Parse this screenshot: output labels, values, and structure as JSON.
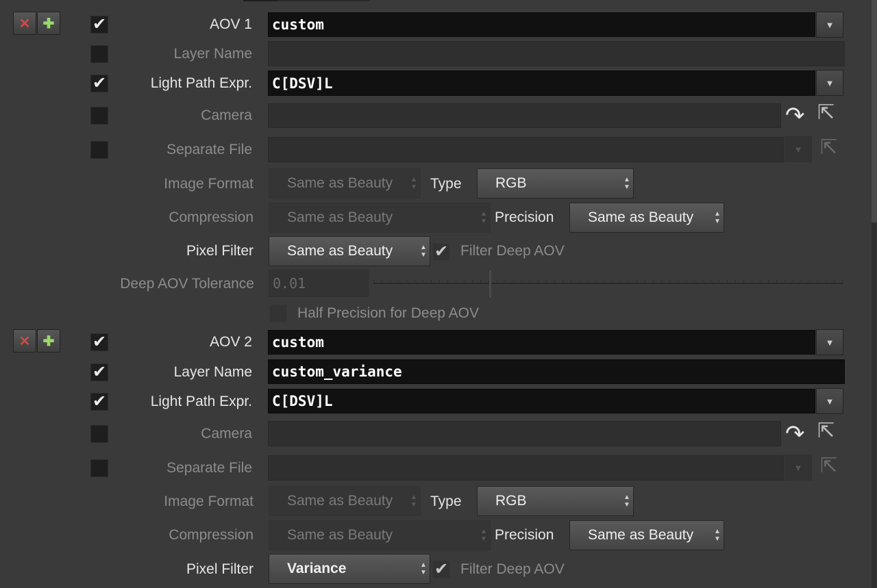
{
  "window": {
    "title": ""
  },
  "aovs": [
    {
      "label": "AOV 1",
      "variable": "custom",
      "layer_name_label": "Layer Name",
      "layer_name": "",
      "lpe_label": "Light Path Expr.",
      "lpe": "C[DSV]L",
      "camera_label": "Camera",
      "separate_file_label": "Separate File",
      "image_format_label": "Image Format",
      "image_format": "Same as Beauty",
      "type_label": "Type",
      "type": "RGB",
      "compression_label": "Compression",
      "compression": "Same as Beauty",
      "precision_label": "Precision",
      "precision": "Same as Beauty",
      "pixel_filter_label": "Pixel Filter",
      "pixel_filter": "Same as Beauty",
      "filter_deep_label": "Filter Deep AOV",
      "deep_tol_label": "Deep AOV Tolerance",
      "deep_tol": "0.01",
      "half_precision_label": "Half Precision for Deep AOV",
      "enabled": true,
      "layer_name_enabled": false,
      "lpe_enabled": true,
      "camera_enabled": false,
      "separate_file_enabled": false,
      "filter_deep_checked": true
    },
    {
      "label": "AOV 2",
      "variable": "custom",
      "layer_name_label": "Layer Name",
      "layer_name": "custom_variance",
      "lpe_label": "Light Path Expr.",
      "lpe": "C[DSV]L",
      "camera_label": "Camera",
      "separate_file_label": "Separate File",
      "image_format_label": "Image Format",
      "image_format": "Same as Beauty",
      "type_label": "Type",
      "type": "RGB",
      "compression_label": "Compression",
      "compression": "Same as Beauty",
      "precision_label": "Precision",
      "precision": "Same as Beauty",
      "pixel_filter_label": "Pixel Filter",
      "pixel_filter": "Variance",
      "filter_deep_label": "Filter Deep AOV",
      "enabled": true,
      "layer_name_enabled": true,
      "lpe_enabled": true,
      "camera_enabled": false,
      "separate_file_enabled": false,
      "filter_deep_checked": true
    }
  ],
  "icons": {
    "remove": "close-icon",
    "insert": "plus-icon",
    "check": "checkmark-icon",
    "dropdown": "triangle-down-icon",
    "camera_jump": "curved-arrow-icon",
    "node_picker": "cursor-pick-icon"
  },
  "colors": {
    "background": "#3a3a3a",
    "field_bg": "#111111",
    "remove_red": "#d24848",
    "insert_green": "#9ad86a"
  }
}
